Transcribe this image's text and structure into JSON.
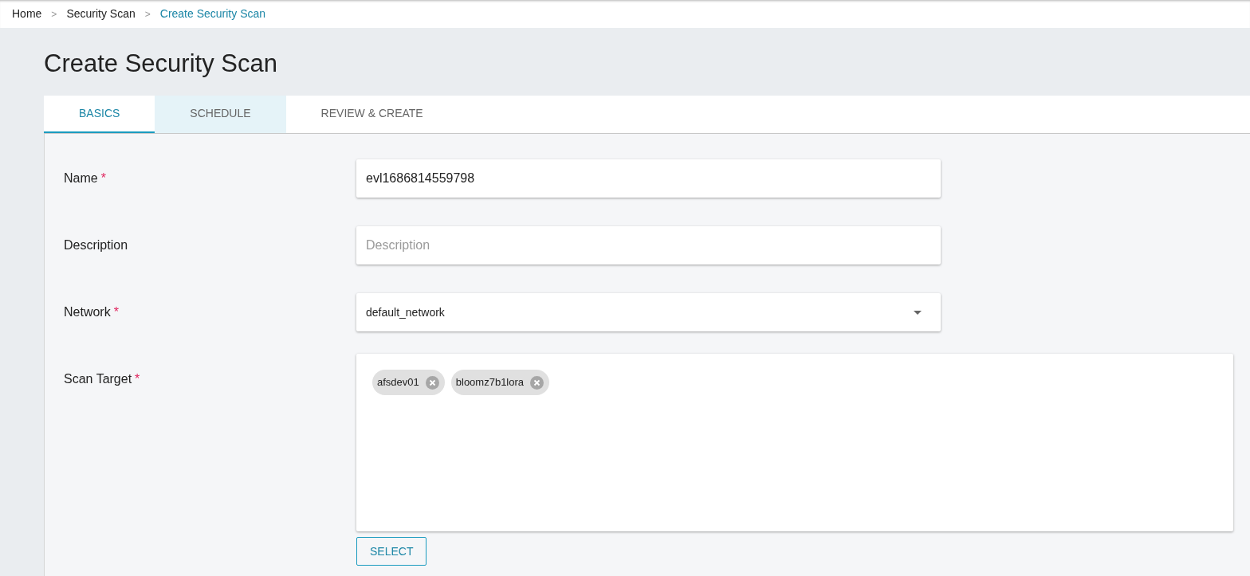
{
  "breadcrumb": [
    {
      "label": "Home",
      "current": false
    },
    {
      "label": "Security Scan",
      "current": false
    },
    {
      "label": "Create Security Scan",
      "current": true
    }
  ],
  "breadcrumb_separator": ">",
  "title": "Create Security Scan",
  "tabs": [
    {
      "label": "BASICS",
      "selected": true,
      "hovered": false
    },
    {
      "label": "SCHEDULE",
      "selected": false,
      "hovered": true
    },
    {
      "label": "REVIEW & CREATE",
      "selected": false,
      "hovered": false
    }
  ],
  "fields": [
    {
      "kind": "text",
      "label": "Name",
      "required_mark": "*",
      "value": "evl1686814559798"
    },
    {
      "kind": "text",
      "label": "Description",
      "placeholder": "Description"
    },
    {
      "kind": "select",
      "label": "Network",
      "required_mark": "*",
      "value": "default_network"
    },
    {
      "kind": "chips",
      "label": "Scan Target",
      "required_mark": "*",
      "chips": [
        "afsdev01",
        "bloomz7b1lora"
      ],
      "button": "SELECT"
    }
  ]
}
